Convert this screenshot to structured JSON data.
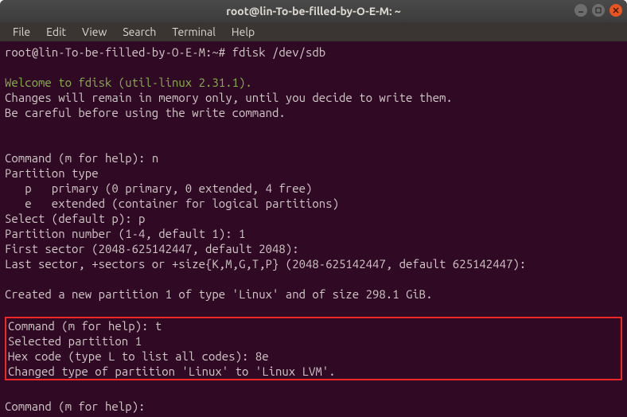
{
  "titlebar": {
    "title": "root@lin-To-be-filled-by-O-E-M: ~"
  },
  "menubar": {
    "items": [
      "File",
      "Edit",
      "View",
      "Search",
      "Terminal",
      "Help"
    ]
  },
  "terminal": {
    "prompt1": "root@lin-To-be-filled-by-O-E-M:~# ",
    "cmd1": "fdisk /dev/sdb",
    "welcome": "Welcome to fdisk (util-linux 2.31.1).",
    "changes1": "Changes will remain in memory only, until you decide to write them.",
    "changes2": "Be careful before using the write command.",
    "cmdhelp1": "Command (m for help): ",
    "input_n": "n",
    "ptype": "Partition type",
    "primary": "   p   primary (0 primary, 0 extended, 4 free)",
    "extended": "   e   extended (container for logical partitions)",
    "select": "Select (default p): ",
    "input_p": "p",
    "partnum": "Partition number (1-4, default 1): ",
    "input_1": "1",
    "firstsec": "First sector (2048-625142447, default 2048):",
    "lastsec": "Last sector, +sectors or +size{K,M,G,T,P} (2048-625142447, default 625142447):",
    "created": "Created a new partition 1 of type 'Linux' and of size 298.1 GiB.",
    "cmdhelp2": "Command (m for help): ",
    "input_t": "t",
    "selected": "Selected partition 1",
    "hexcode": "Hex code (type L to list all codes): ",
    "input_8e": "8e",
    "changed": "Changed type of partition 'Linux' to 'Linux LVM'.",
    "cmdhelp3": "Command (m for help):"
  }
}
